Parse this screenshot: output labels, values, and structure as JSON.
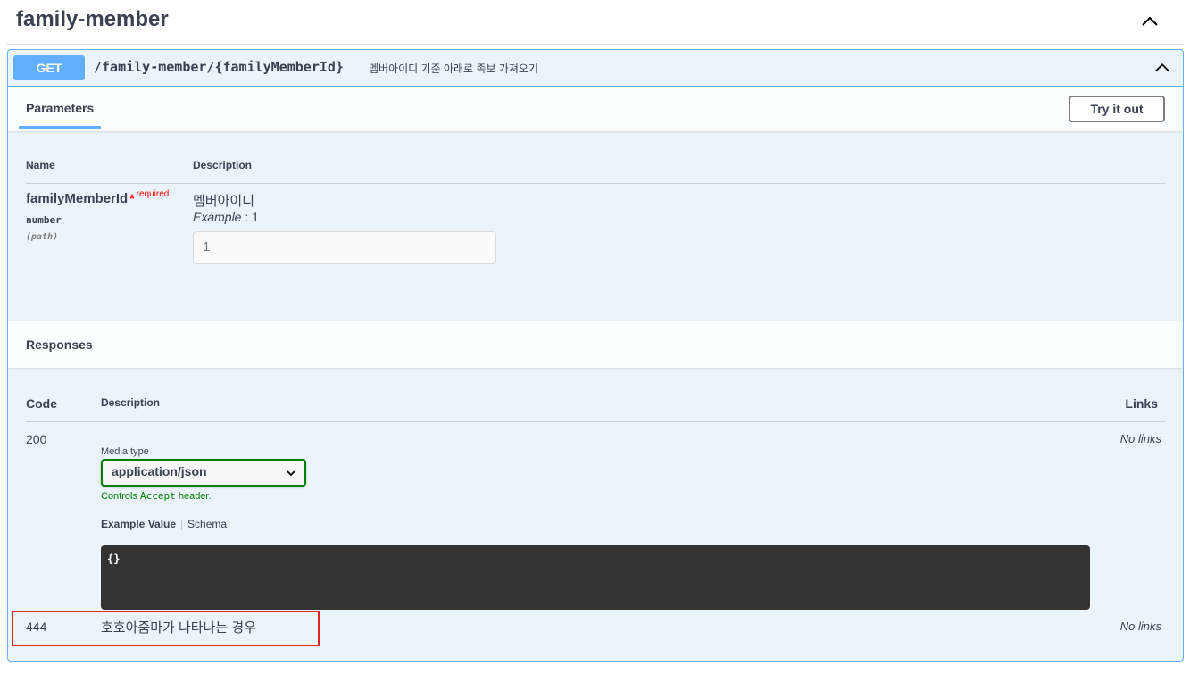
{
  "tag": {
    "title": "family-member"
  },
  "operation": {
    "method": "GET",
    "path": "/family-member/{familyMemberId}",
    "summary": "멤버아이디 기준 아래로 족보 가져오기"
  },
  "parameters": {
    "tab_label": "Parameters",
    "try_label": "Try it out",
    "col_name": "Name",
    "col_description": "Description",
    "items": [
      {
        "name": "familyMemberId",
        "required_star": "*",
        "required_label": "required",
        "type": "number",
        "in": "(path)",
        "description": "멤버아이디",
        "example_label": "Example",
        "example_sep": " : ",
        "example_value": "1",
        "input_value": "1"
      }
    ]
  },
  "responses": {
    "title": "Responses",
    "col_code": "Code",
    "col_description": "Description",
    "col_links": "Links",
    "items": [
      {
        "code": "200",
        "media_type_label": "Media type",
        "media_type_value": "application/json",
        "controls_prefix": "Controls ",
        "controls_code": "Accept",
        "controls_suffix": " header.",
        "example_tab": "Example Value",
        "schema_tab": "Schema",
        "example_body": "{}",
        "links": "No links"
      },
      {
        "code": "444",
        "description": "호호아줌마가 나타나는 경우",
        "links": "No links"
      }
    ]
  },
  "colors": {
    "get_blue": "#61affe",
    "block_bg": "#ebf3fb",
    "highlight_red": "#e0271d",
    "controls_green": "#008000"
  }
}
